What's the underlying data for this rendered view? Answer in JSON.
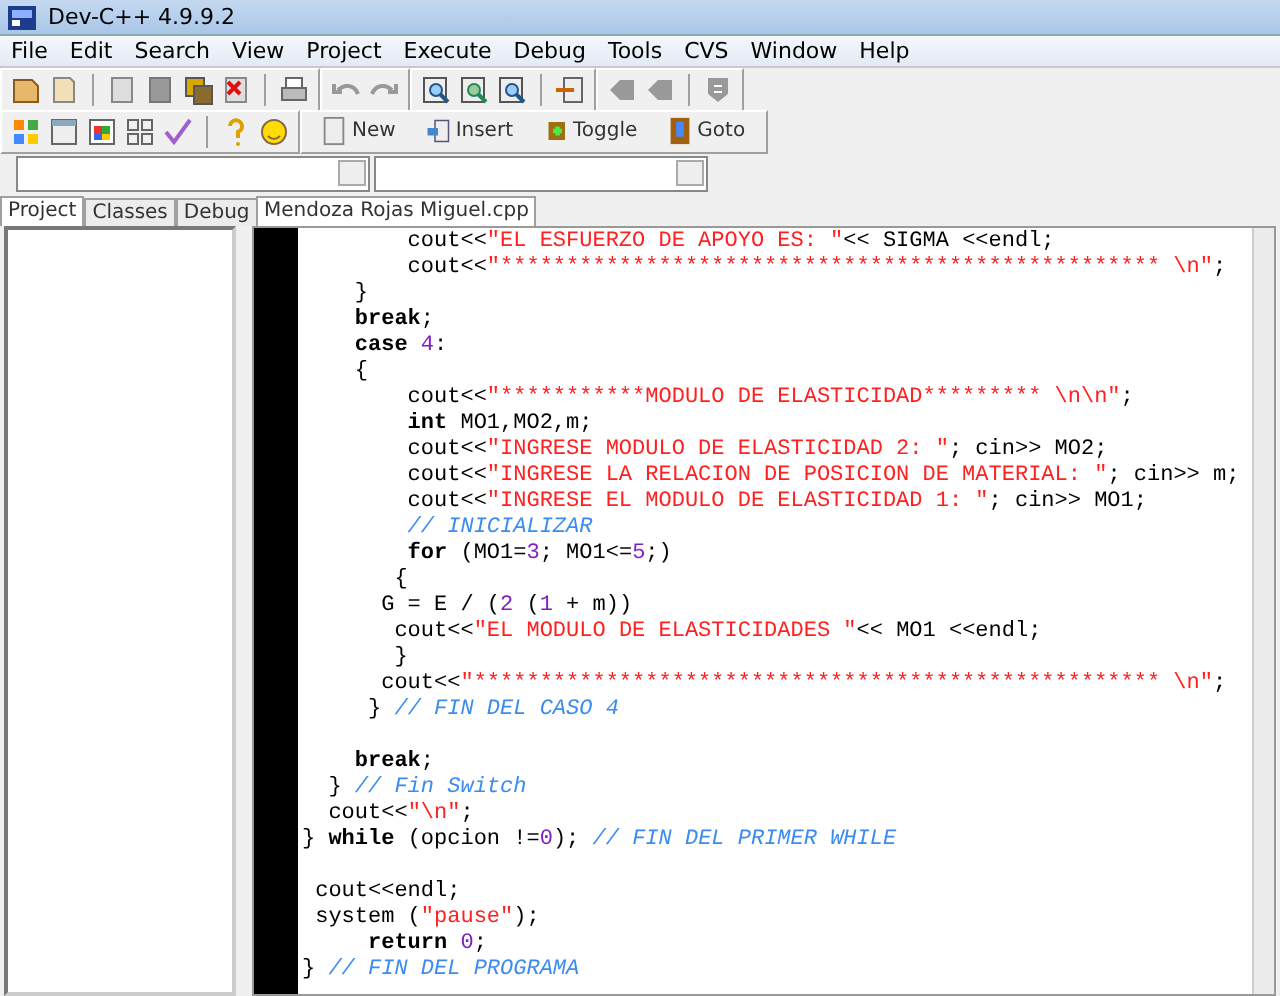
{
  "window": {
    "title": "Dev-C++ 4.9.9.2"
  },
  "menu": [
    "File",
    "Edit",
    "Search",
    "View",
    "Project",
    "Execute",
    "Debug",
    "Tools",
    "CVS",
    "Window",
    "Help"
  ],
  "toolbar_buttons": [
    {
      "kind": "new",
      "label": "New"
    },
    {
      "kind": "insert",
      "label": "Insert"
    },
    {
      "kind": "toggle",
      "label": "Toggle"
    },
    {
      "kind": "goto",
      "label": "Goto"
    }
  ],
  "panel_tabs": [
    {
      "label": "Project",
      "selected": true
    },
    {
      "label": "Classes",
      "selected": false
    },
    {
      "label": "Debug",
      "selected": false
    }
  ],
  "editor_tabs": [
    {
      "label": "Mendoza Rojas Miguel.cpp",
      "selected": true
    }
  ],
  "code_blocks": [
    [
      {
        "tokens": [
          {
            "kind": "id",
            "text": "        cout<<"
          },
          {
            "kind": "str",
            "text": "\"EL ESFUERZO DE APOYO ES: \""
          },
          {
            "kind": "id",
            "text": "<< SIGMA <<endl;"
          }
        ]
      },
      {
        "tokens": [
          {
            "kind": "id",
            "text": "        cout<<"
          },
          {
            "kind": "str",
            "text": "\"************************************************** \\n\""
          },
          {
            "kind": "id",
            "text": ";"
          }
        ]
      },
      {
        "tokens": [
          {
            "kind": "id",
            "text": "    }"
          }
        ]
      },
      {
        "tokens": [
          {
            "kind": "kw",
            "text": "    break"
          },
          {
            "kind": "id",
            "text": ";"
          }
        ]
      },
      {
        "tokens": [
          {
            "kind": "kw",
            "text": "    case "
          },
          {
            "kind": "num",
            "text": "4"
          },
          {
            "kind": "id",
            "text": ":"
          }
        ]
      },
      {
        "tokens": [
          {
            "kind": "id",
            "text": "    {"
          }
        ]
      },
      {
        "tokens": [
          {
            "kind": "id",
            "text": "        cout<<"
          },
          {
            "kind": "str",
            "text": "\"***********MODULO DE ELASTICIDAD********* \\n\\n\""
          },
          {
            "kind": "id",
            "text": ";"
          }
        ]
      },
      {
        "tokens": [
          {
            "kind": "kw",
            "text": "        int"
          },
          {
            "kind": "id",
            "text": " MO1,MO2,m;"
          }
        ]
      },
      {
        "tokens": [
          {
            "kind": "id",
            "text": "        cout<<"
          },
          {
            "kind": "str",
            "text": "\"INGRESE MODULO DE ELASTICIDAD 2: \""
          },
          {
            "kind": "id",
            "text": "; cin>> MO2;"
          }
        ]
      },
      {
        "tokens": [
          {
            "kind": "id",
            "text": "        cout<<"
          },
          {
            "kind": "str",
            "text": "\"INGRESE LA RELACION DE POSICION DE MATERIAL: \""
          },
          {
            "kind": "id",
            "text": "; cin>> m;"
          }
        ]
      },
      {
        "tokens": [
          {
            "kind": "id",
            "text": "        cout<<"
          },
          {
            "kind": "str",
            "text": "\"INGRESE EL MODULO DE ELASTICIDAD 1: \""
          },
          {
            "kind": "id",
            "text": "; cin>> MO1;"
          }
        ]
      },
      {
        "tokens": [
          {
            "kind": "com",
            "text": "        // INICIALIZAR"
          }
        ]
      },
      {
        "tokens": [
          {
            "kind": "kw",
            "text": "        for"
          },
          {
            "kind": "id",
            "text": " (MO1="
          },
          {
            "kind": "num",
            "text": "3"
          },
          {
            "kind": "id",
            "text": "; MO1<="
          },
          {
            "kind": "num",
            "text": "5"
          },
          {
            "kind": "id",
            "text": ";)"
          }
        ]
      },
      {
        "tokens": [
          {
            "kind": "id",
            "text": "       {"
          }
        ]
      },
      {
        "tokens": [
          {
            "kind": "id",
            "text": "      G = E / ("
          },
          {
            "kind": "num",
            "text": "2"
          },
          {
            "kind": "id",
            "text": " ("
          },
          {
            "kind": "num",
            "text": "1"
          },
          {
            "kind": "id",
            "text": " + m))"
          }
        ]
      },
      {
        "tokens": [
          {
            "kind": "id",
            "text": "       cout<<"
          },
          {
            "kind": "str",
            "text": "\"EL MODULO DE ELASTICIDADES \""
          },
          {
            "kind": "id",
            "text": "<< MO1 <<endl;"
          }
        ]
      },
      {
        "tokens": [
          {
            "kind": "id",
            "text": "       }"
          }
        ]
      },
      {
        "tokens": [
          {
            "kind": "id",
            "text": "      cout<<"
          },
          {
            "kind": "str",
            "text": "\"**************************************************** \\n\""
          },
          {
            "kind": "id",
            "text": ";"
          }
        ]
      },
      {
        "tokens": [
          {
            "kind": "id",
            "text": "     } "
          },
          {
            "kind": "com",
            "text": "// FIN DEL CASO 4"
          }
        ]
      }
    ],
    [
      {
        "tokens": [
          {
            "kind": "kw",
            "text": "    break"
          },
          {
            "kind": "id",
            "text": ";"
          }
        ]
      },
      {
        "tokens": [
          {
            "kind": "id",
            "text": "  } "
          },
          {
            "kind": "com",
            "text": "// Fin Switch"
          }
        ]
      },
      {
        "tokens": [
          {
            "kind": "id",
            "text": "  cout<<"
          },
          {
            "kind": "str",
            "text": "\"\\n\""
          },
          {
            "kind": "id",
            "text": ";"
          }
        ]
      },
      {
        "tokens": [
          {
            "kind": "id",
            "text": "} "
          },
          {
            "kind": "kw",
            "text": "while"
          },
          {
            "kind": "id",
            "text": " (opcion !="
          },
          {
            "kind": "num",
            "text": "0"
          },
          {
            "kind": "id",
            "text": "); "
          },
          {
            "kind": "com",
            "text": "// FIN DEL PRIMER WHILE"
          }
        ]
      }
    ],
    [
      {
        "tokens": [
          {
            "kind": "id",
            "text": " cout<<endl;"
          }
        ]
      },
      {
        "tokens": [
          {
            "kind": "id",
            "text": " system ("
          },
          {
            "kind": "str",
            "text": "\"pause\""
          },
          {
            "kind": "id",
            "text": ");"
          }
        ]
      },
      {
        "tokens": [
          {
            "kind": "kw",
            "text": "     return "
          },
          {
            "kind": "num",
            "text": "0"
          },
          {
            "kind": "id",
            "text": ";"
          }
        ]
      },
      {
        "tokens": [
          {
            "kind": "id",
            "text": "} "
          },
          {
            "kind": "com",
            "text": "// FIN DEL PROGRAMA"
          }
        ]
      }
    ]
  ]
}
